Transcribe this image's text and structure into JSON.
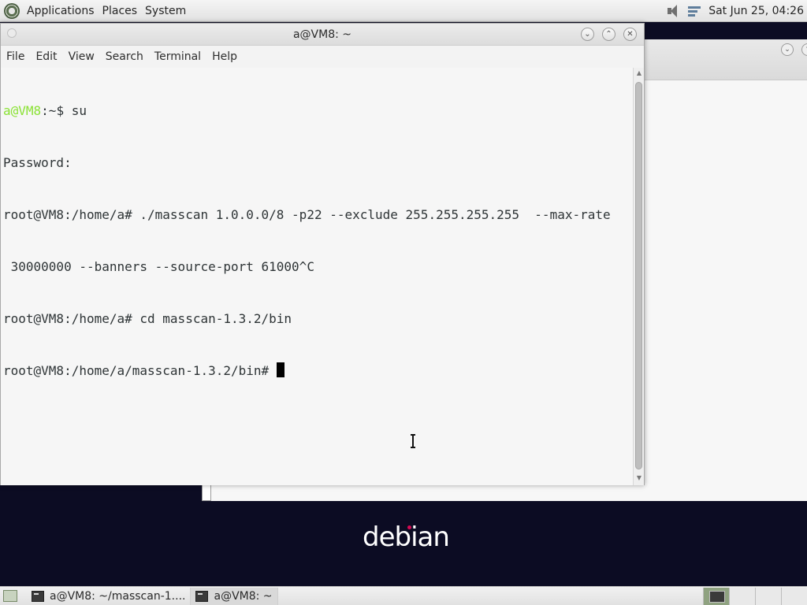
{
  "top_panel": {
    "menus": [
      "Applications",
      "Places",
      "System"
    ],
    "clock": "Sat Jun 25, 04:26"
  },
  "terminal": {
    "title": "a@VM8: ~",
    "menu": [
      "File",
      "Edit",
      "View",
      "Search",
      "Terminal",
      "Help"
    ],
    "lines": {
      "l1_user": "a@VM8",
      "l1_rest": ":~$ su",
      "l2": "Password:",
      "l3": "root@VM8:/home/a# ./masscan 1.0.0.0/8 -p22 --exclude 255.255.255.255  --max-rate",
      "l4": " 30000000 --banners --source-port 61000^C",
      "l5": "root@VM8:/home/a# cd masscan-1.3.2/bin",
      "l6": "root@VM8:/home/a/masscan-1.3.2/bin# "
    }
  },
  "wallpaper": {
    "logo_text": "debian",
    "accent": "#d70a53"
  },
  "taskbar": {
    "tasks": [
      "a@VM8: ~/masscan-1....",
      "a@VM8: ~"
    ]
  },
  "icons": {
    "menu_logo": "debian-swirl-icon",
    "volume": "speaker-icon",
    "network": "network-icon",
    "terminal": "terminal-icon"
  }
}
